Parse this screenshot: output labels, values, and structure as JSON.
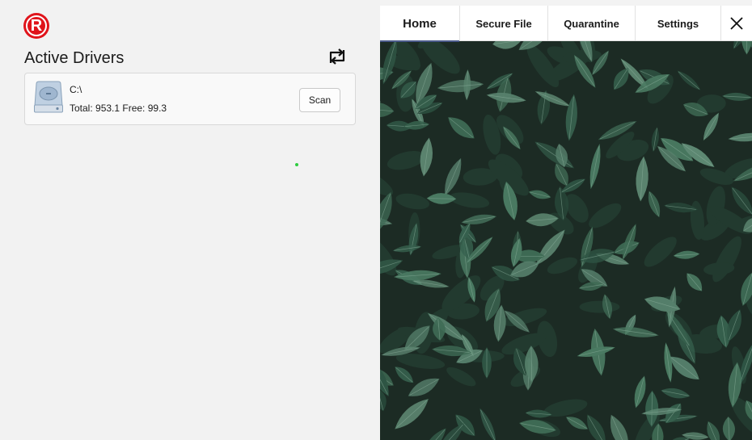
{
  "app": {
    "logo_letter": "R",
    "brand_color": "#e0141b"
  },
  "drivers": {
    "title": "Active Drivers",
    "refresh_icon": "refresh-swap-icon",
    "items": [
      {
        "name": "C:\\",
        "stats": "Total: 953.1 Free: 99.3",
        "scan_label": "Scan",
        "icon": "hard-drive-icon"
      }
    ]
  },
  "status": {
    "dot_color": "#2ecc40"
  },
  "tabs": [
    {
      "label": "Home",
      "active": true
    },
    {
      "label": "Secure File",
      "active": false
    },
    {
      "label": "Quarantine",
      "active": false
    },
    {
      "label": "Settings",
      "active": false
    }
  ],
  "close_icon": "close-icon"
}
